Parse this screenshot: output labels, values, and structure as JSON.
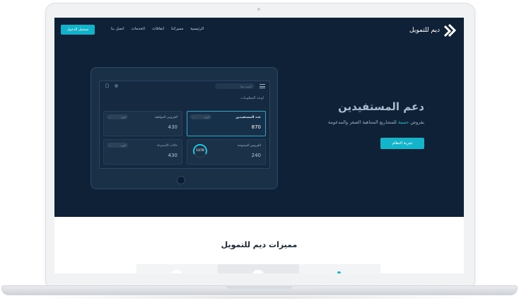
{
  "nav": {
    "login_label": "تسجيل الدخول",
    "menu": [
      "الرئيسية",
      "مميزاتنا",
      "اتفاقات",
      "الخدمات",
      "اتصل بنا"
    ],
    "logo_text": "ديم للتمويل"
  },
  "hero": {
    "title": "دعم المستفيدين",
    "subtitle_prefix": "بقروض ",
    "subtitle_accent": "حسنة",
    "subtitle_rest": " للمشاريع المتناهية الصغر والمدعومة",
    "cta_label": "تجربة النظام"
  },
  "dashboard": {
    "search_placeholder": "البحث هنا",
    "heading": "لوحة المعلومات",
    "cards": [
      {
        "title": "عدد المستفيدين",
        "value": "870",
        "pill": "اليوم"
      },
      {
        "title": "القروض الموافقة",
        "value": "430",
        "pill": "اليوم"
      },
      {
        "title": "القروض الممنوحة",
        "value": "240",
        "gauge_value": "1078"
      },
      {
        "title": "حالات الاسترداد",
        "value": "430",
        "pill": "اليوم"
      }
    ]
  },
  "section": {
    "title": "مميزات ديم للتمويل"
  },
  "colors": {
    "hero_bg": "#0f2136",
    "accent": "#14b5cb"
  }
}
